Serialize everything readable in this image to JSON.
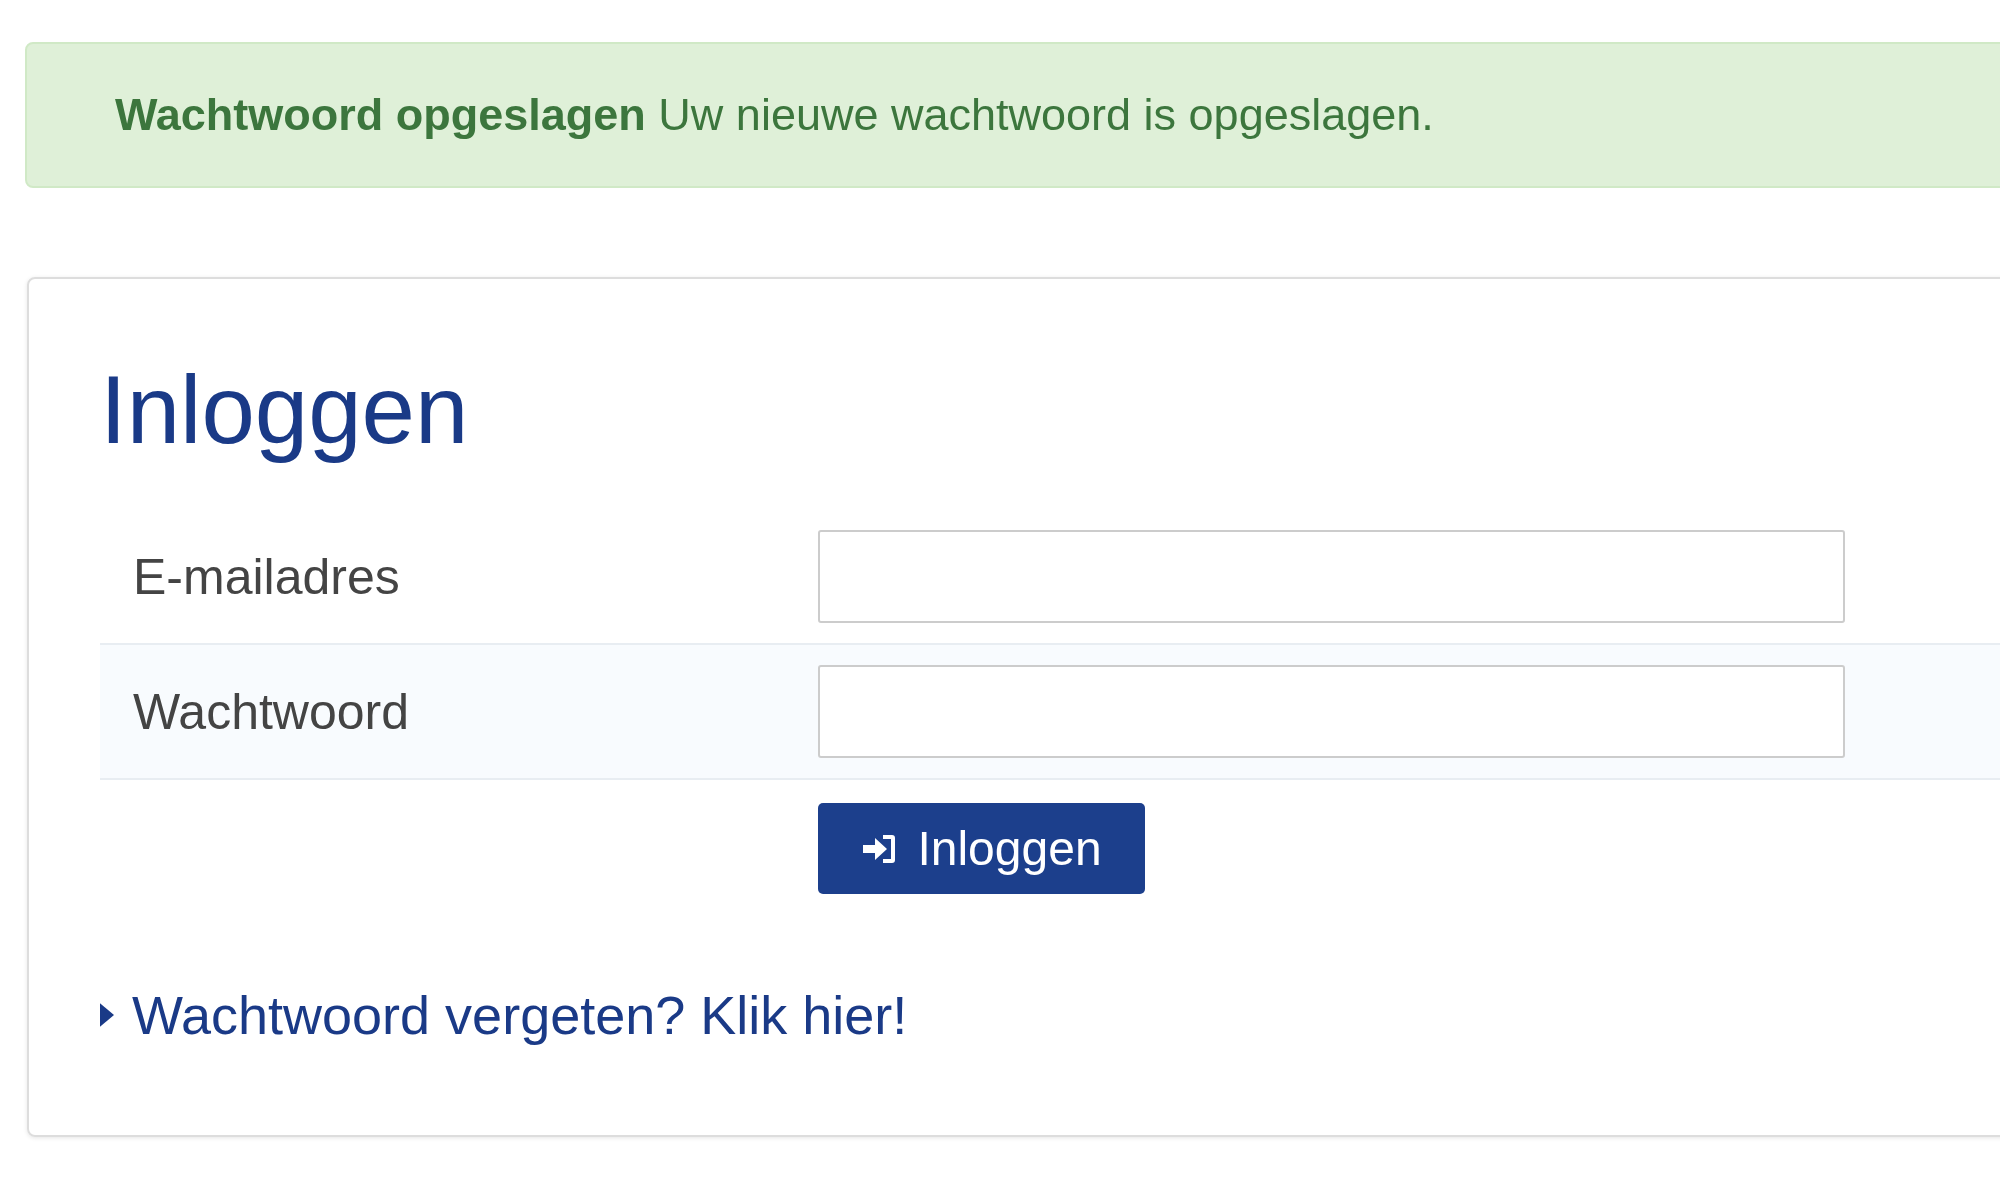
{
  "alert": {
    "text": "**Wachtwoord opgeslagen** Uw nieuwe wachtwoord is opgeslagen."
  },
  "login": {
    "heading": "Inloggen",
    "fields": [
      {
        "label": "E-mailadres"
      },
      {
        "label": "Wachtwoord"
      }
    ],
    "button": "Inloggen",
    "forgot_link": "Wachtwoord vergeten? Klik hier!"
  }
}
